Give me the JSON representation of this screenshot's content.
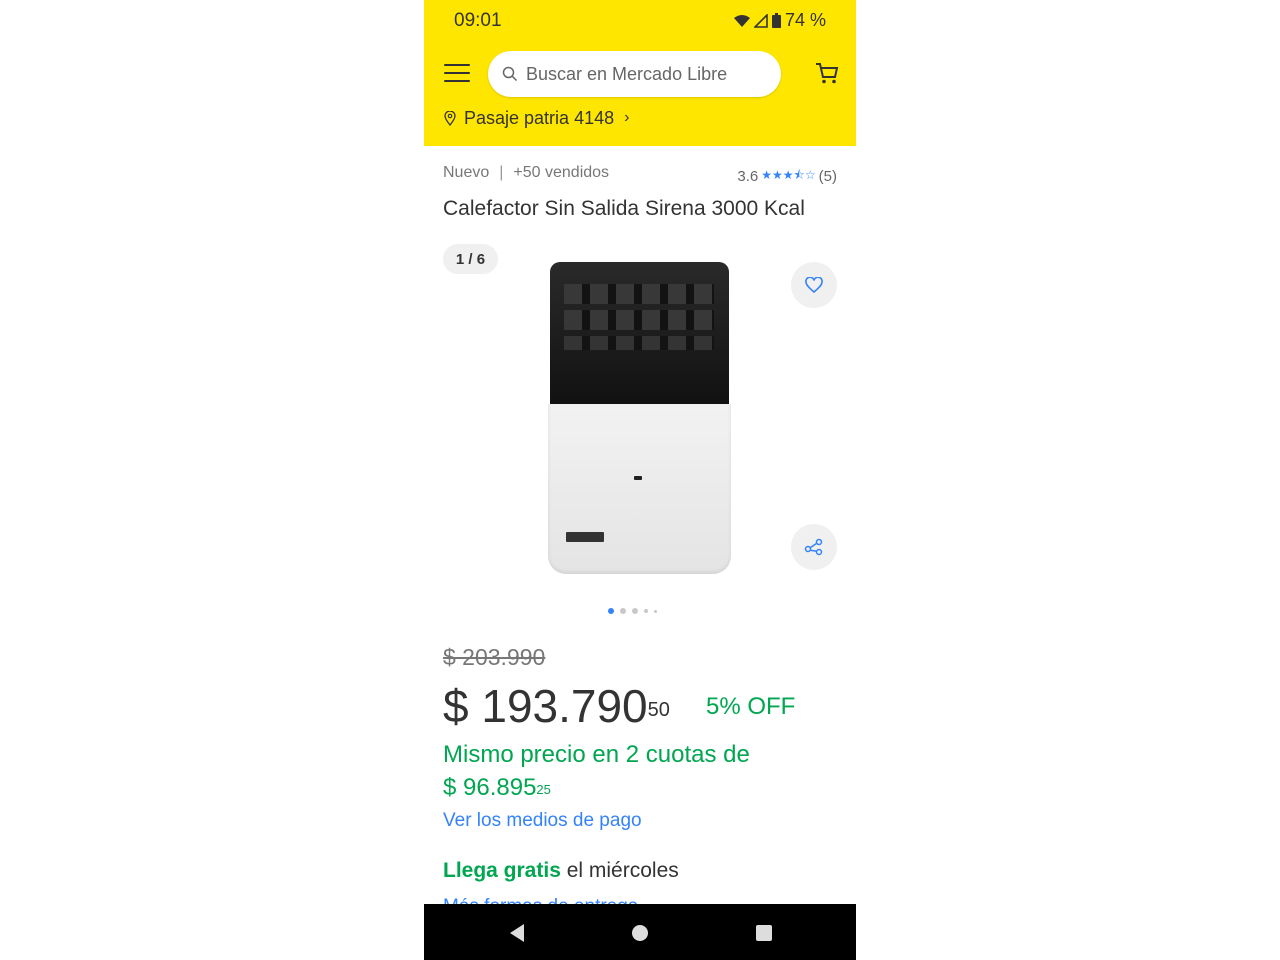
{
  "status_bar": {
    "time": "09:01",
    "battery": "74 %"
  },
  "header": {
    "search_placeholder": "Buscar en Mercado Libre",
    "location": "Pasaje patria 4148"
  },
  "product": {
    "condition": "Nuevo",
    "sold": "+50 vendidos",
    "rating_value": "3.6",
    "rating_stars": 3.5,
    "rating_count": "(5)",
    "title": "Calefactor Sin Salida Sirena 3000 Kcal",
    "image_counter": "1 / 6",
    "original_price": "$ 203.990",
    "price_main": "$ 193.790",
    "price_cents": "50",
    "discount": "5% OFF",
    "installments_line": "Mismo precio en 2 cuotas de",
    "installment_amount": "$ 96.895",
    "installment_cents": "25",
    "payment_link": "Ver los medios de pago",
    "shipping_highlight": "Llega gratis",
    "shipping_day": "el miércoles",
    "next_link_partial": "Más formas de entrega"
  },
  "colors": {
    "header_yellow": "#ffe600",
    "green": "#00a650",
    "blue": "#3483fa"
  },
  "icons": [
    "menu-icon",
    "search-icon",
    "cart-icon",
    "location-pin-icon",
    "heart-icon",
    "share-icon",
    "star-icon",
    "back-icon",
    "home-icon",
    "recents-icon"
  ]
}
